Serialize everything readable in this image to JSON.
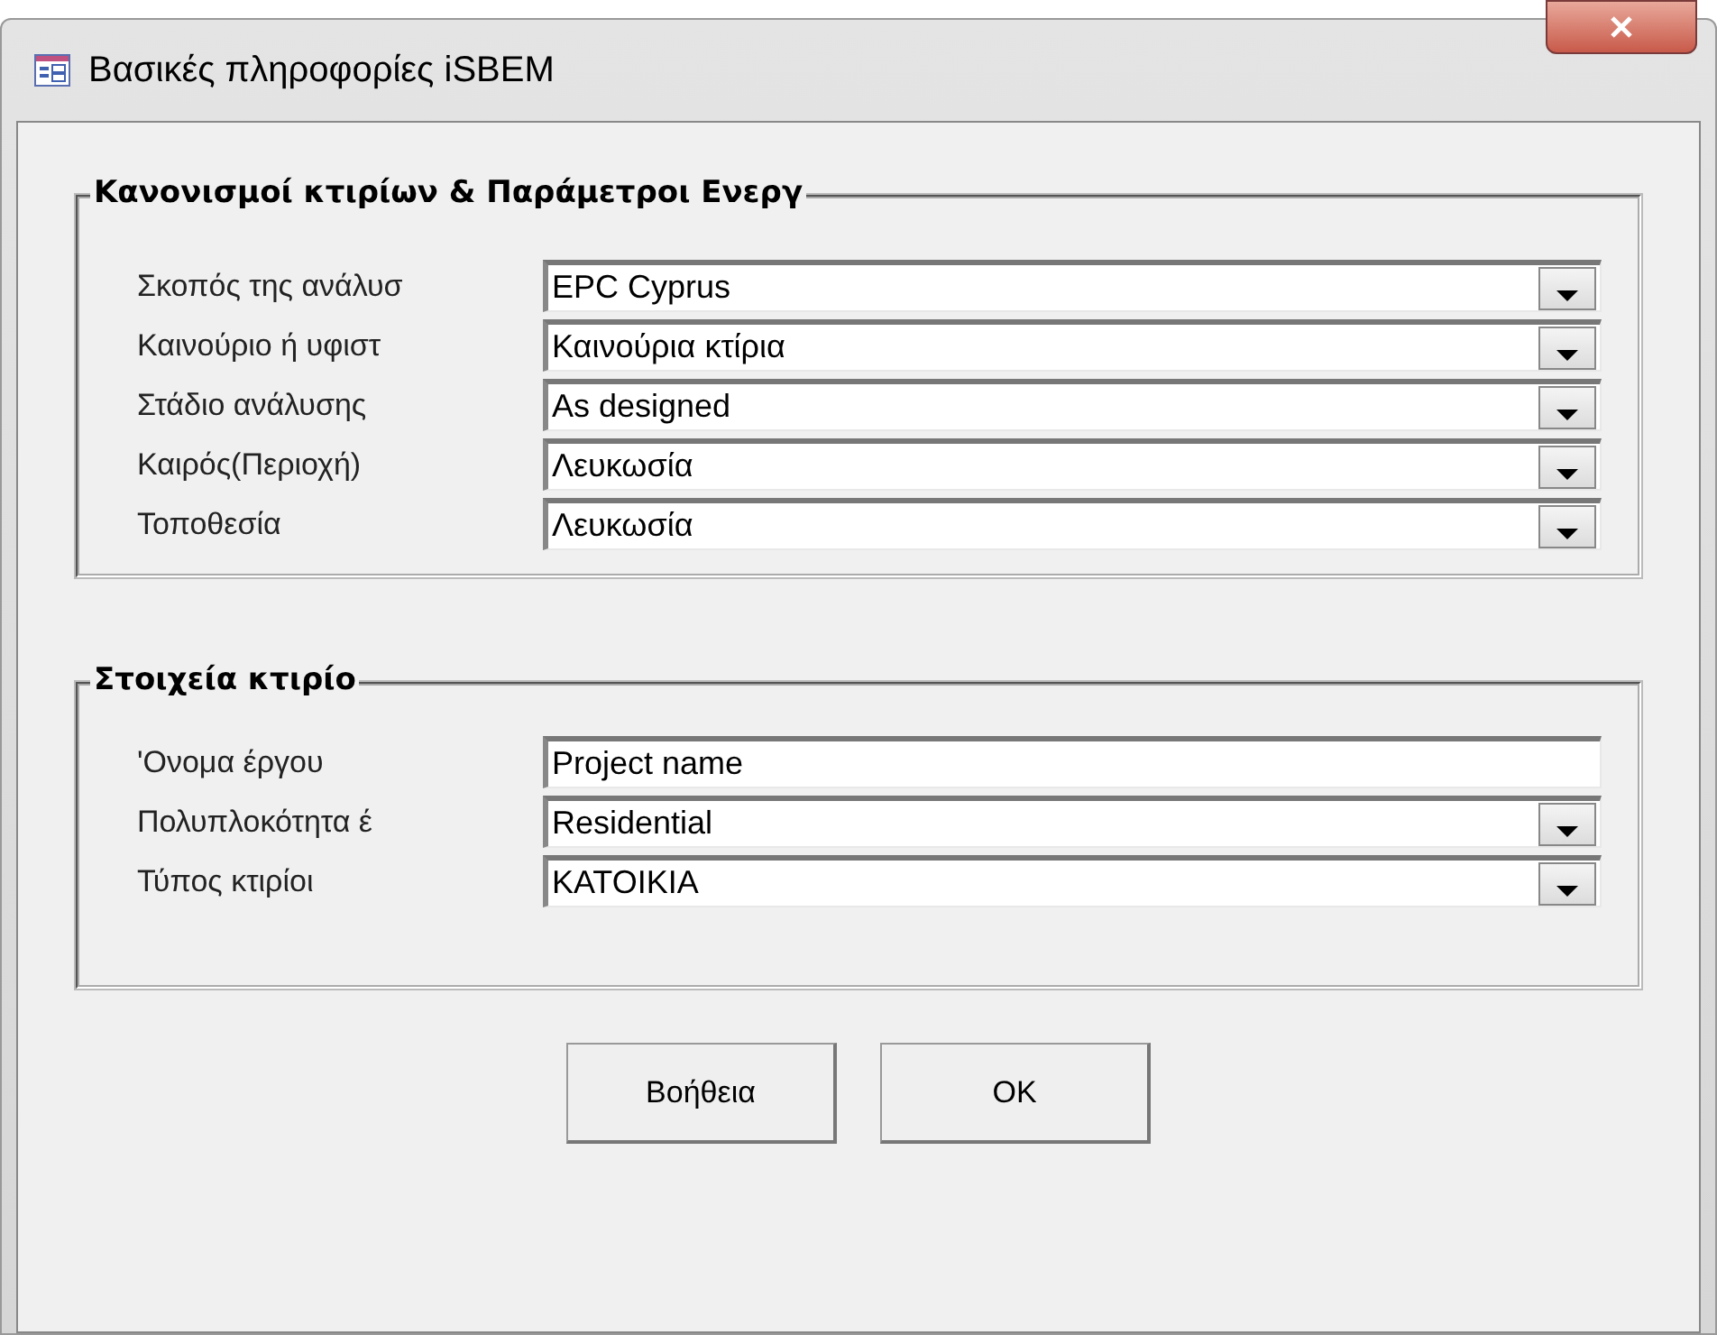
{
  "window": {
    "title": "Βασικές πληροφορίες iSBEM"
  },
  "groups": [
    {
      "title": "Κανονισμοί κτιρίων & Παράμετροι Ενεργ",
      "fields": [
        {
          "label": "Σκοπός της ανάλυσ",
          "kind": "combo",
          "value": "EPC Cyprus"
        },
        {
          "label": "Καινούριο ή υφιστ",
          "kind": "combo",
          "value": "Καινούρια κτίρια"
        },
        {
          "label": "Στάδιο ανάλυσης",
          "kind": "combo",
          "value": "As designed"
        },
        {
          "label": "Καιρός(Περιοχή)",
          "kind": "combo",
          "value": "Λευκωσία"
        },
        {
          "label": "Τοποθεσία",
          "kind": "combo",
          "value": "Λευκωσία"
        }
      ]
    },
    {
      "title": "Στοιχεία κτιρίο",
      "fields": [
        {
          "label": "'Ονομα έργου",
          "kind": "text",
          "value": "Project name"
        },
        {
          "label": "Πολυπλοκότητα έ",
          "kind": "combo",
          "value": "Residential"
        },
        {
          "label": "Τύπος κτιρίοι",
          "kind": "combo",
          "value": "ΚΑΤΟΙΚΙΑ"
        }
      ]
    }
  ],
  "buttons": [
    "Βοήθεια",
    "OK"
  ]
}
